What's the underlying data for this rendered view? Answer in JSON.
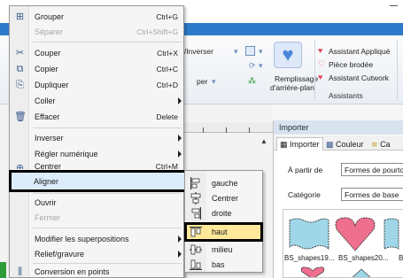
{
  "window": {
    "title": ""
  },
  "ribbon": {
    "inverser_label": "r/Inverser",
    "per_label": "per",
    "remplissage_label_1": "Remplissage",
    "remplissage_label_2": "d'arrière-plan",
    "assistant_applique": "Assistant Appliqué",
    "piece_brodee": "Pièce brodée",
    "assistant_cutwork": "Assistant Cutwork",
    "group_label": "Assistants",
    "colors": {
      "tabs": "#2c7ac9",
      "heart": "#e0455b"
    }
  },
  "import_panel": {
    "title": "Importer",
    "tabs": [
      {
        "label": "Importer",
        "icon": "grid-icon"
      },
      {
        "label": "Couleur",
        "icon": "palette-icon"
      },
      {
        "label": "Ca",
        "icon": "thread-icon"
      }
    ],
    "from_label": "À partir de",
    "from_value": "Formes de pourtour",
    "category_label": "Catégorie",
    "category_value": "Formes de base",
    "thumbnails": [
      {
        "caption": "BS_shapes19...",
        "color": "#9fd6e8"
      },
      {
        "caption": "BS_shapes20...",
        "color": "#ee6f8e"
      },
      {
        "caption": "B",
        "color": "#9fd6e8"
      }
    ]
  },
  "context_menu": {
    "items": [
      {
        "label": "Grouper",
        "shortcut": "Ctrl+G",
        "icon": "group-icon",
        "enabled": true,
        "submenu": false
      },
      {
        "label": "Séparer",
        "shortcut": "Ctrl+Shift+G",
        "icon": "",
        "enabled": false,
        "submenu": false
      },
      {
        "label": "Couper",
        "shortcut": "Ctrl+X",
        "icon": "scissors-icon",
        "enabled": true,
        "submenu": false
      },
      {
        "label": "Copier",
        "shortcut": "Ctrl+C",
        "icon": "copy-icon",
        "enabled": true,
        "submenu": false
      },
      {
        "label": "Dupliquer",
        "shortcut": "Ctrl+D",
        "icon": "duplicate-icon",
        "enabled": true,
        "submenu": false
      },
      {
        "label": "Coller",
        "shortcut": "",
        "icon": "",
        "enabled": true,
        "submenu": true
      },
      {
        "label": "Effacer",
        "shortcut": "Delete",
        "icon": "trash-icon",
        "enabled": true,
        "submenu": false
      },
      {
        "label": "Inverser",
        "shortcut": "",
        "icon": "",
        "enabled": true,
        "submenu": true
      },
      {
        "label": "Régler numérique",
        "shortcut": "",
        "icon": "",
        "enabled": true,
        "submenu": true
      },
      {
        "label": "Centrer",
        "shortcut": "Ctrl+M",
        "icon": "center-icon",
        "enabled": true,
        "submenu": false
      },
      {
        "label": "Aligner",
        "shortcut": "",
        "icon": "",
        "enabled": true,
        "submenu": true,
        "highlighted": true
      },
      {
        "label": "Ouvrir",
        "shortcut": "",
        "icon": "",
        "enabled": true,
        "submenu": false
      },
      {
        "label": "Fermer",
        "shortcut": "",
        "icon": "",
        "enabled": false,
        "submenu": false
      },
      {
        "label": "Modifier les superpositions",
        "shortcut": "",
        "icon": "",
        "enabled": true,
        "submenu": true
      },
      {
        "label": "Relief/gravure",
        "shortcut": "",
        "icon": "",
        "enabled": true,
        "submenu": true
      },
      {
        "label": "Conversion en points",
        "shortcut": "",
        "icon": "convert-icon",
        "enabled": true,
        "submenu": false
      }
    ]
  },
  "align_submenu": {
    "items": [
      {
        "label": "gauche",
        "icon": "align-left-icon"
      },
      {
        "label": "Centrer",
        "icon": "align-center-icon"
      },
      {
        "label": "droite",
        "icon": "align-right-icon"
      },
      {
        "label": "haut",
        "icon": "align-top-icon",
        "highlighted": true
      },
      {
        "label": "milieu",
        "icon": "align-middle-icon"
      },
      {
        "label": "bas",
        "icon": "align-bottom-icon"
      }
    ]
  }
}
